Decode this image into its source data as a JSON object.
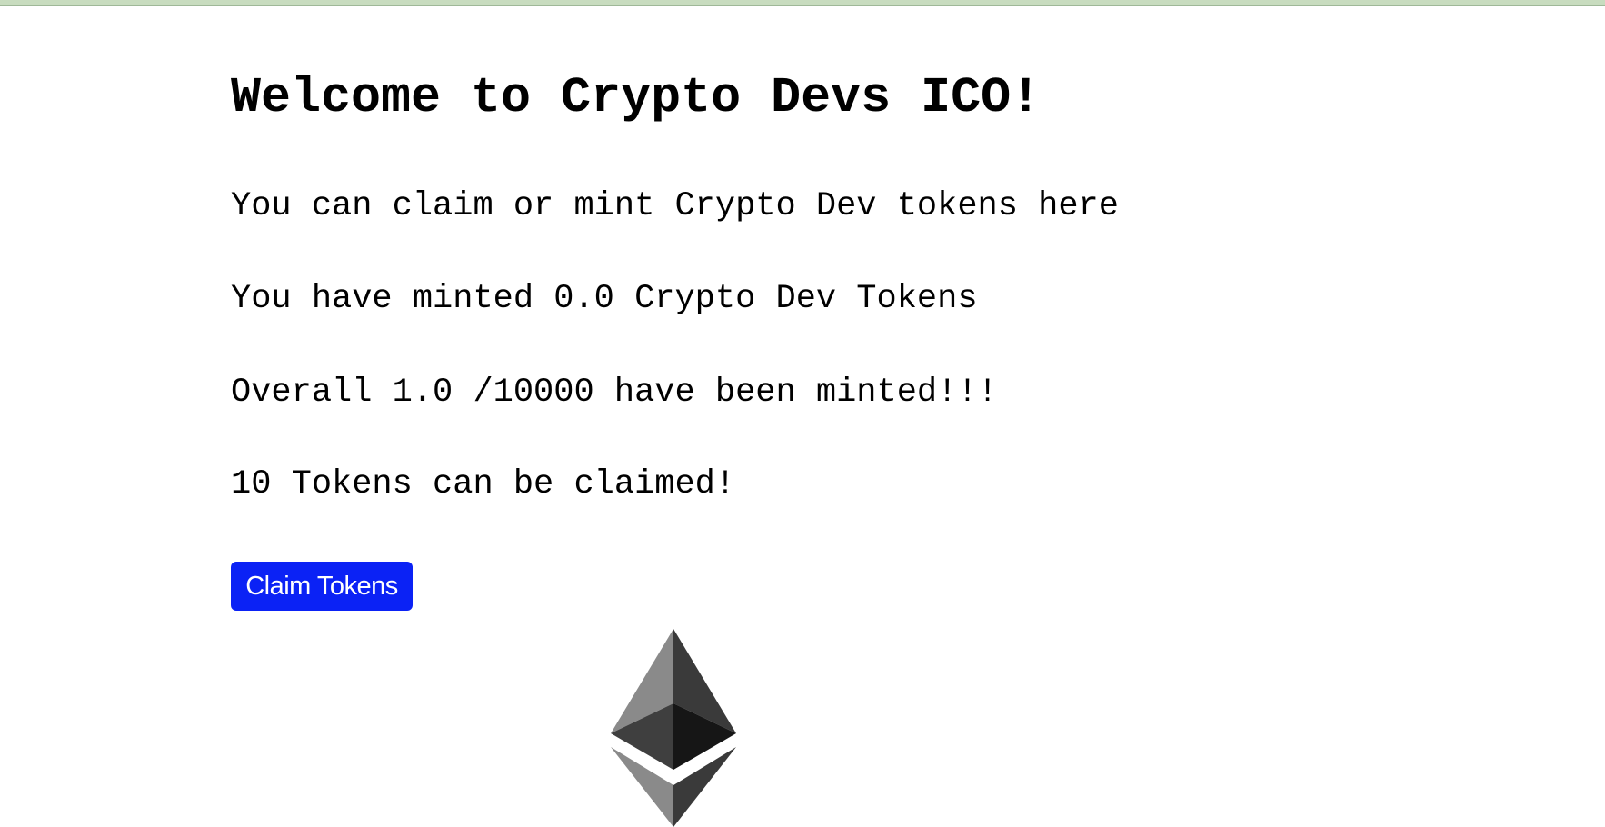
{
  "page": {
    "title": "Welcome to Crypto Devs ICO!",
    "intro": "You can claim or mint Crypto Dev tokens here",
    "minted_by_user": "You have minted 0.0 Crypto Dev Tokens",
    "overall_minted": "Overall 1.0 /10000 have been minted!!!",
    "claimable": "10 Tokens can be claimed!",
    "claim_button_label": "Claim Tokens"
  },
  "icons": {
    "logo": "ethereum-logo-icon"
  },
  "colors": {
    "button_background": "#0b22f5",
    "button_text": "#ffffff",
    "top_strip": "#c8dcbf"
  }
}
